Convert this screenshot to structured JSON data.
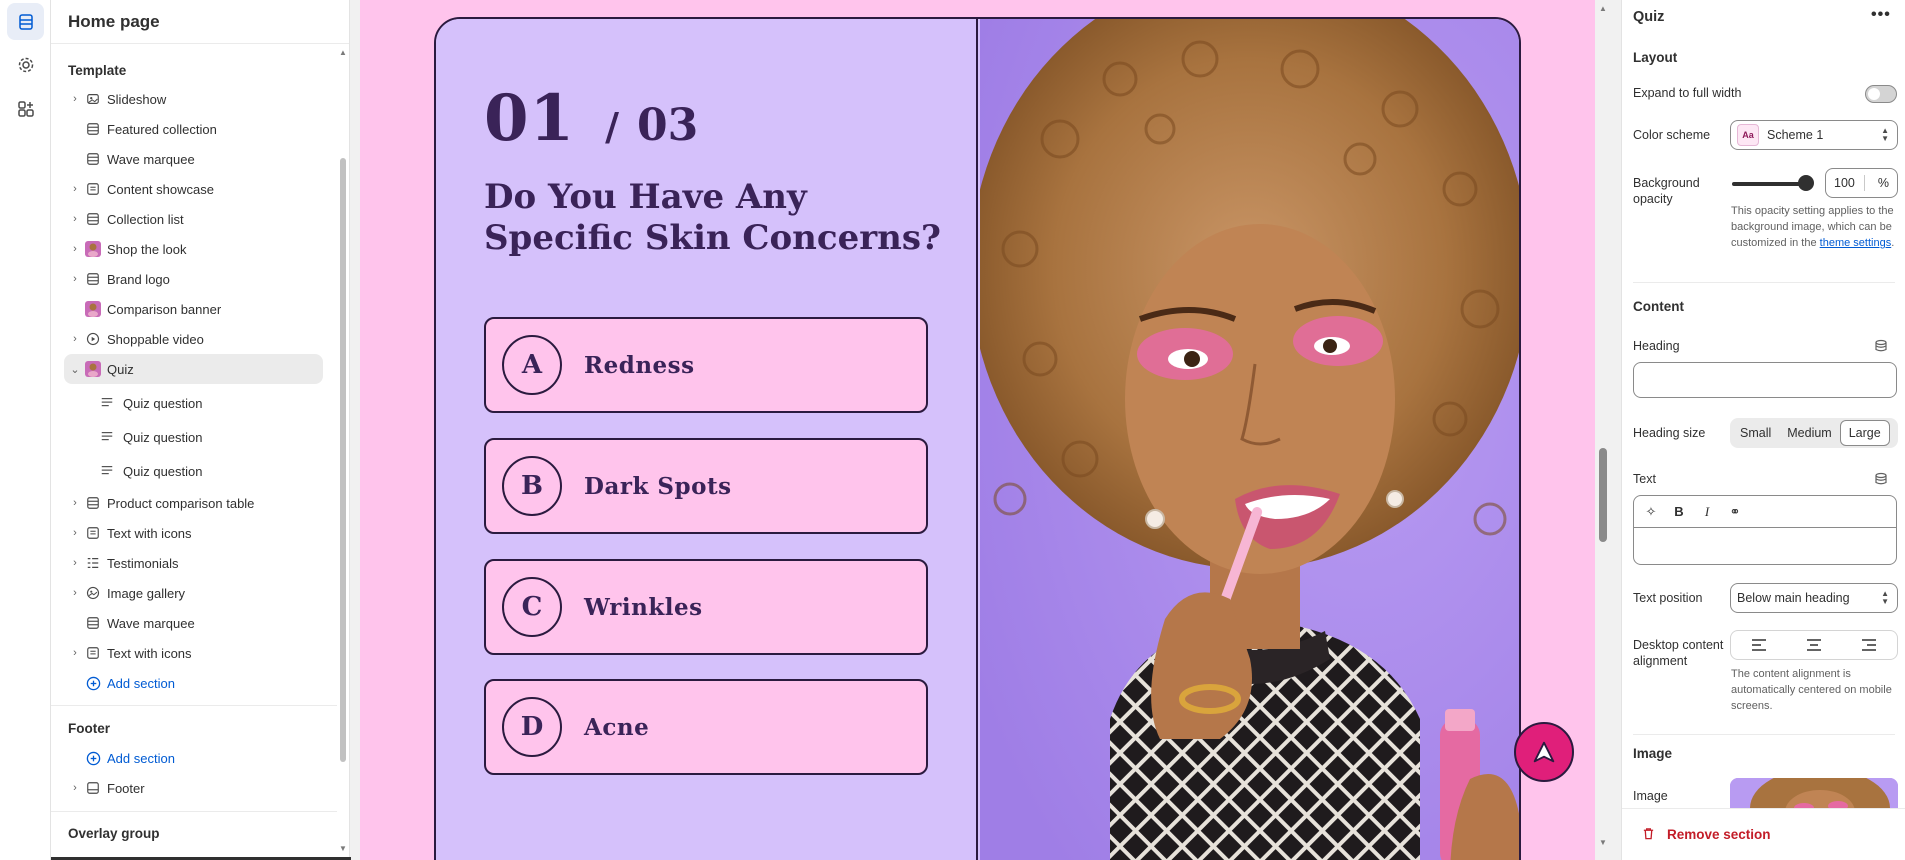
{
  "header": {
    "title": "Home page"
  },
  "rail": {
    "icons": [
      "sections-icon",
      "settings-icon",
      "apps-icon"
    ]
  },
  "sidebar": {
    "template_title": "Template",
    "items": [
      {
        "label": "Slideshow",
        "icon": "slideshow-icon",
        "expandable": true
      },
      {
        "label": "Featured collection",
        "icon": "layout-icon",
        "expandable": false
      },
      {
        "label": "Wave marquee",
        "icon": "layout-icon",
        "expandable": false
      },
      {
        "label": "Content showcase",
        "icon": "text-block-icon",
        "expandable": true
      },
      {
        "label": "Collection list",
        "icon": "layout-icon",
        "expandable": true
      },
      {
        "label": "Shop the look",
        "icon": "image-thumb-icon",
        "expandable": true
      },
      {
        "label": "Brand logo",
        "icon": "layout-icon",
        "expandable": true
      },
      {
        "label": "Comparison banner",
        "icon": "image-thumb-icon",
        "expandable": false
      },
      {
        "label": "Shoppable video",
        "icon": "play-icon",
        "expandable": true
      },
      {
        "label": "Quiz",
        "icon": "image-thumb-icon",
        "expandable": true,
        "selected": true
      },
      {
        "label": "Quiz question",
        "icon": "text-lines-icon",
        "child": true
      },
      {
        "label": "Quiz question",
        "icon": "text-lines-icon",
        "child": true
      },
      {
        "label": "Quiz question",
        "icon": "text-lines-icon",
        "child": true
      },
      {
        "label": "Product comparison table",
        "icon": "layout-icon",
        "expandable": true
      },
      {
        "label": "Text with icons",
        "icon": "text-block-icon",
        "expandable": true
      },
      {
        "label": "Testimonials",
        "icon": "list-icon",
        "expandable": true
      },
      {
        "label": "Image gallery",
        "icon": "gallery-icon",
        "expandable": true
      },
      {
        "label": "Wave marquee",
        "icon": "layout-icon",
        "expandable": false
      },
      {
        "label": "Text with icons",
        "icon": "text-block-icon",
        "expandable": true
      }
    ],
    "add_section": "Add section",
    "footer_title": "Footer",
    "footer_add_section": "Add section",
    "footer_item": "Footer",
    "overlay_title": "Overlay group"
  },
  "preview": {
    "question_number": "01",
    "question_sep": "/",
    "question_total": "03",
    "question": "Do You Have Any Specific Skin Concerns?",
    "answers": [
      {
        "letter": "A",
        "label": "Redness"
      },
      {
        "letter": "B",
        "label": "Dark Spots"
      },
      {
        "letter": "C",
        "label": "Wrinkles"
      },
      {
        "letter": "D",
        "label": "Acne"
      }
    ],
    "colors": {
      "background": "#ffc4ec",
      "panel": "#d5c1fb",
      "ink": "#3a2358",
      "accent": "#e01f7a"
    }
  },
  "settings": {
    "title": "Quiz",
    "more": "•••",
    "layout_title": "Layout",
    "expand_label": "Expand to full width",
    "expand_value": false,
    "color_scheme_label": "Color scheme",
    "color_scheme_value": "Scheme 1",
    "swatch_text": "Aa",
    "bg_opacity_label": "Background opacity",
    "bg_opacity_value": "100",
    "bg_opacity_unit": "%",
    "bg_opacity_help": "This opacity setting applies to the background image, which can be customized in the",
    "bg_opacity_link": "theme settings",
    "content_title": "Content",
    "heading_label": "Heading",
    "heading_value": "",
    "heading_size_label": "Heading size",
    "heading_sizes": [
      "Small",
      "Medium",
      "Large"
    ],
    "heading_size_selected": "Large",
    "text_label": "Text",
    "text_position_label": "Text position",
    "text_position_value": "Below main heading",
    "alignment_label": "Desktop content alignment",
    "alignment_help": "The content alignment is automatically centered on mobile screens.",
    "image_title": "Image",
    "image_label": "Image",
    "remove_label": "Remove section"
  }
}
